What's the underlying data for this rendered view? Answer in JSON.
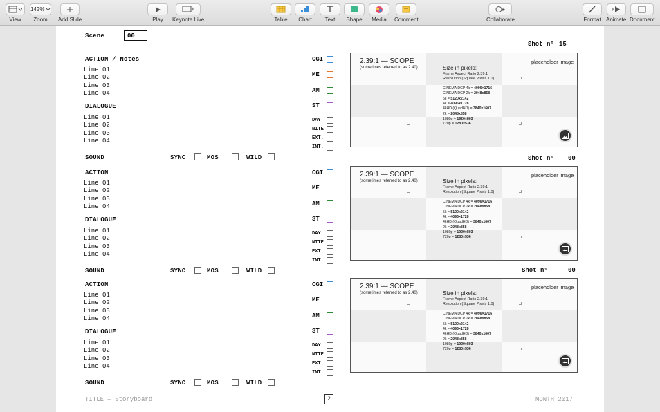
{
  "toolbar": {
    "view": "View",
    "zoom_value": "142%",
    "zoom": "Zoom",
    "add_slide": "Add Slide",
    "play": "Play",
    "keynote_live": "Keynote Live",
    "table": "Table",
    "chart": "Chart",
    "text": "Text",
    "shape": "Shape",
    "media": "Media",
    "comment": "Comment",
    "collaborate": "Collaborate",
    "format": "Format",
    "animate": "Animate",
    "document": "Document"
  },
  "slide": {
    "scene_label": "Scene",
    "scene_value": "00",
    "footer_title": "TITLE — Storyboard",
    "page_number": "2",
    "footer_date": "MONTH 2017",
    "sections": [
      {
        "action_heading": "ACTION / Notes",
        "action_lines": [
          "Line 01",
          "Line 02",
          "Line 03",
          "Line 04"
        ],
        "dialogue_heading": "DIALOGUE",
        "dialogue_lines": [
          "Line 01",
          "Line 02",
          "Line 03",
          "Line 04"
        ],
        "sound": "SOUND",
        "sync": "SYNC",
        "mos": "MOS",
        "wild": "WILD",
        "shot_label": "Shot n°",
        "shot_number": "15"
      },
      {
        "action_heading": "ACTION",
        "action_lines": [
          "Line 01",
          "Line 02",
          "Line 03",
          "Line 04"
        ],
        "dialogue_heading": "DIALOGUE",
        "dialogue_lines": [
          "Line 01",
          "Line 02",
          "Line 03",
          "Line 04"
        ],
        "sound": "SOUND",
        "sync": "SYNC",
        "mos": "MOS",
        "wild": "WILD",
        "shot_label": "Shot n°",
        "shot_number": "00"
      },
      {
        "action_heading": "ACTION",
        "action_lines": [
          "Line 01",
          "Line 02",
          "Line 03",
          "Line 04"
        ],
        "dialogue_heading": "DIALOGUE",
        "dialogue_lines": [
          "Line 01",
          "Line 02",
          "Line 03",
          "Line 04"
        ],
        "sound": "SOUND",
        "sync": "SYNC",
        "mos": "MOS",
        "wild": "WILD",
        "shot_label": "Shot n°",
        "shot_number": "00"
      }
    ],
    "tags": {
      "cgi": "CGI",
      "me": "ME",
      "am": "AM",
      "st": "ST",
      "day": "DAY",
      "nite": "NITE",
      "ext": "EXT.",
      "int": "INT.",
      "colors": {
        "cgi": "#3a8fd8",
        "me": "#e8772e",
        "am": "#2e8b3a",
        "st": "#a35cc8"
      }
    },
    "frame": {
      "title": "2.39:1 — SCOPE",
      "subtitle": "(sometimes referred to as 2.40)",
      "size_heading": "Size in pixels:",
      "aspect": "Frame Aspect Ratio 2.39:1",
      "resolution": "Resolution (Square Pixels 1.0)",
      "specs": [
        {
          "label": "CINEMA DCP 4k = ",
          "value": "4096×1716"
        },
        {
          "label": "CINEMA DCP 2k = ",
          "value": "2048x858"
        },
        {
          "label": "5k = ",
          "value": "5120x2142"
        },
        {
          "label": "4k = ",
          "value": "4096×1728"
        },
        {
          "label": "4kHD (QuadHD) = ",
          "value": "3840x1607"
        },
        {
          "label": "2k = ",
          "value": "2048x858"
        },
        {
          "label": "1080p = ",
          "value": "1920×803"
        },
        {
          "label": "720p = ",
          "value": "1280×536"
        }
      ],
      "placeholder": "placeholder image",
      "icon": "image-icon"
    }
  }
}
